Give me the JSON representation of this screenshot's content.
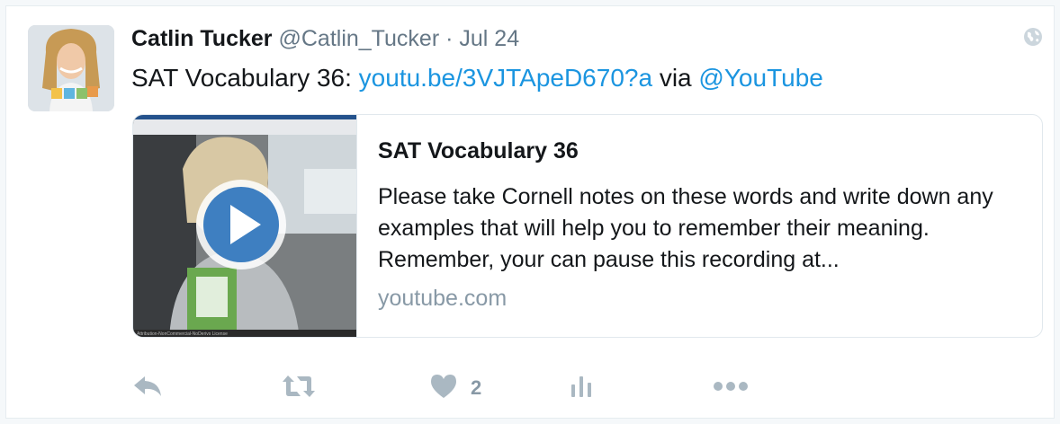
{
  "tweet": {
    "author_name": "Catlin Tucker",
    "handle": "@Catlin_Tucker",
    "separator": "·",
    "time": "Jul 24",
    "text_prefix": "SAT Vocabulary 36: ",
    "link": "youtu.be/3VJTApeD670?a",
    "text_middle": " via ",
    "mention": "@YouTube"
  },
  "card": {
    "title": "SAT Vocabulary 36",
    "description": "Please take Cornell notes on these words and write down any examples that will help you to remember their meaning. Remember, your can pause this recording at...",
    "domain": "youtube.com",
    "thumbnail_caption": "Attribution-NonCommercial-NoDerivs License"
  },
  "actions": {
    "reply_icon": "reply-icon",
    "retweet_icon": "retweet-icon",
    "like_icon": "heart-icon",
    "like_count": "2",
    "analytics_icon": "bar-chart-icon",
    "more_icon": "more-dots-icon"
  },
  "colors": {
    "link": "#1b95e0",
    "muted": "#657786",
    "icon": "#aab8c2",
    "text": "#14171a"
  }
}
